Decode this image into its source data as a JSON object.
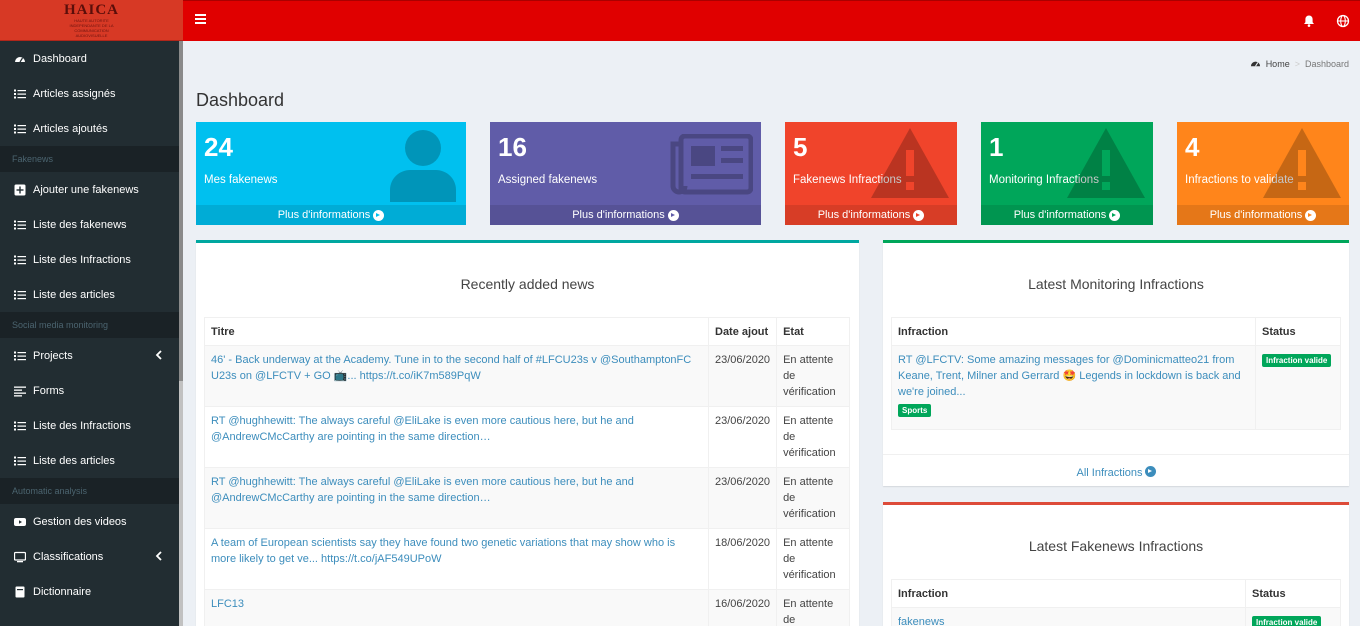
{
  "logo": {
    "title": "HAICA",
    "subtitle": "HAUTE AUTORITE INDEPENDANTE DE LA COMMUNICATION AUDIOVISUELLE"
  },
  "colors": {
    "navbar": "#e00000",
    "sidebar": "#222d32",
    "aqua": "#00c0ef",
    "purple": "#605ca8",
    "red": "#f0442b",
    "green": "#00a65a",
    "orange": "#ff851b"
  },
  "sidebar": {
    "items": [
      {
        "label": "Dashboard",
        "icon": "dashboard-icon"
      },
      {
        "label": "Articles assignés",
        "icon": "list-icon"
      },
      {
        "label": "Articles ajoutés",
        "icon": "list-icon"
      }
    ],
    "header_fakenews": "Fakenews",
    "fakenews_items": [
      {
        "label": "Ajouter une fakenews",
        "icon": "plus-square-icon"
      },
      {
        "label": "Liste des fakenews",
        "icon": "list-icon"
      },
      {
        "label": "Liste des Infractions",
        "icon": "list-icon"
      },
      {
        "label": "Liste des articles",
        "icon": "list-icon"
      }
    ],
    "header_social": "Social media monitoring",
    "social_items": [
      {
        "label": "Projects",
        "icon": "list-icon"
      },
      {
        "label": "Forms",
        "icon": "align-left-icon"
      },
      {
        "label": "Liste des Infractions",
        "icon": "list-icon"
      },
      {
        "label": "Liste des articles",
        "icon": "list-icon"
      }
    ],
    "header_auto": "Automatic analysis",
    "auto_items": [
      {
        "label": "Gestion des videos",
        "icon": "youtube-icon"
      },
      {
        "label": "Classifications",
        "icon": "tv-icon"
      },
      {
        "label": "Dictionnaire",
        "icon": "book-icon"
      }
    ]
  },
  "breadcrumb": {
    "home": "Home",
    "current": "Dashboard"
  },
  "page_title": "Dashboard",
  "stat_boxes": [
    {
      "value": "24",
      "label": "Mes fakenews",
      "link": "Plus d'informations",
      "color": "#00c0ef",
      "icon": "user-icon"
    },
    {
      "value": "16",
      "label": "Assigned fakenews",
      "link": "Plus d'informations",
      "color": "#605ca8",
      "icon": "newspaper-icon"
    },
    {
      "value": "5",
      "label": "Fakenews Infractions",
      "link": "Plus d'informations",
      "color": "#f0442b",
      "icon": "warning-icon"
    },
    {
      "value": "1",
      "label": "Monitoring Infractions",
      "link": "Plus d'informations",
      "color": "#00a65a",
      "icon": "warning-icon"
    },
    {
      "value": "4",
      "label": "Infractions to validate",
      "link": "Plus d'informations",
      "color": "#ff851b",
      "icon": "warning-icon"
    }
  ],
  "recent_news": {
    "title": "Recently added news",
    "headers": [
      "Titre",
      "Date ajout",
      "Etat"
    ],
    "rows": [
      {
        "title": "46' - Back underway at the Academy. Tune in to the second half of #LFCU23s v @SouthamptonFC U23s on @LFCTV + GO 📺... https://t.co/iK7m589PqW",
        "date": "23/06/2020",
        "state": "En attente de vérification"
      },
      {
        "title": "RT @hughhewitt: The always careful @EliLake is even more cautious here, but he and @AndrewCMcCarthy are pointing in the same direction…",
        "date": "23/06/2020",
        "state": "En attente de vérification"
      },
      {
        "title": "RT @hughhewitt: The always careful @EliLake is even more cautious here, but he and @AndrewCMcCarthy are pointing in the same direction…",
        "date": "23/06/2020",
        "state": "En attente de vérification"
      },
      {
        "title": "A team of European scientists say they have found two genetic variations that may show who is more likely to get ve... https://t.co/jAF549UPoW",
        "date": "18/06/2020",
        "state": "En attente de vérification"
      },
      {
        "title": "LFC13",
        "date": "16/06/2020",
        "state": "En attente de vérification"
      }
    ]
  },
  "monitoring": {
    "title": "Latest Monitoring Infractions",
    "headers": [
      "Infraction",
      "Status"
    ],
    "rows": [
      {
        "text": "RT @LFCTV: Some amazing messages for @Dominicmatteo21 from Keane, Trent, Milner and Gerrard 🤩 Legends in lockdown is back and we're joined...",
        "tag": "Sports",
        "status": "Infraction valide"
      }
    ],
    "all_link": "All Infractions"
  },
  "fakenews_inf": {
    "title": "Latest Fakenews Infractions",
    "headers": [
      "Infraction",
      "Status"
    ],
    "rows": [
      {
        "text": "fakenews",
        "status": "Infraction valide"
      }
    ]
  }
}
